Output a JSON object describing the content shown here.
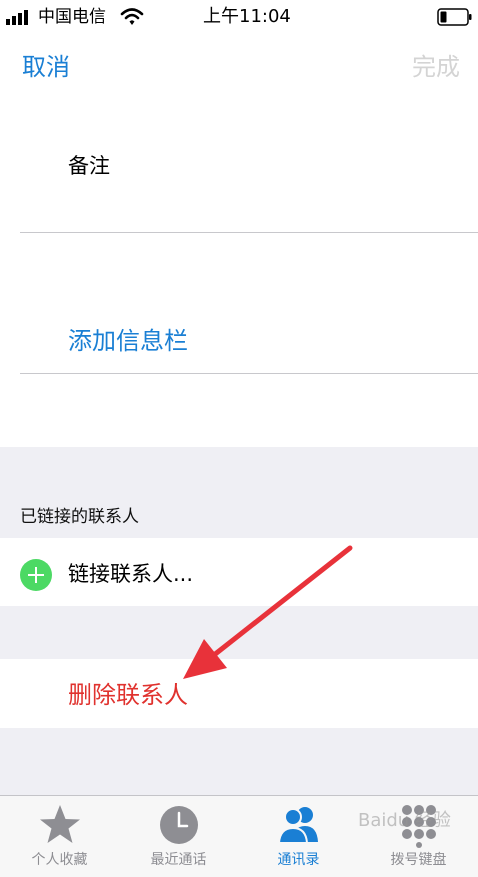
{
  "status_bar": {
    "carrier": "中国电信",
    "time": "上午11:04"
  },
  "nav": {
    "cancel_label": "取消",
    "done_label": "完成"
  },
  "notes": {
    "label": "备注"
  },
  "add_field": {
    "label": "添加信息栏"
  },
  "linked_contacts": {
    "header": "已链接的联系人",
    "link_label": "链接联系人..."
  },
  "delete_contact": {
    "label": "删除联系人"
  },
  "tab_bar": {
    "tabs": [
      {
        "label": "个人收藏",
        "icon": "star-icon",
        "active": false
      },
      {
        "label": "最近通话",
        "icon": "clock-icon",
        "active": false
      },
      {
        "label": "通讯录",
        "icon": "contacts-icon",
        "active": true
      },
      {
        "label": "拨号键盘",
        "icon": "keypad-icon",
        "active": false
      }
    ]
  },
  "watermark": {
    "text": "Baidu 经验"
  },
  "colors": {
    "accent": "#1a7fd4",
    "destructive": "#e0322e",
    "add_green": "#4cd964",
    "arrow_red": "#e8323a",
    "grouped_background": "#efeff4"
  }
}
